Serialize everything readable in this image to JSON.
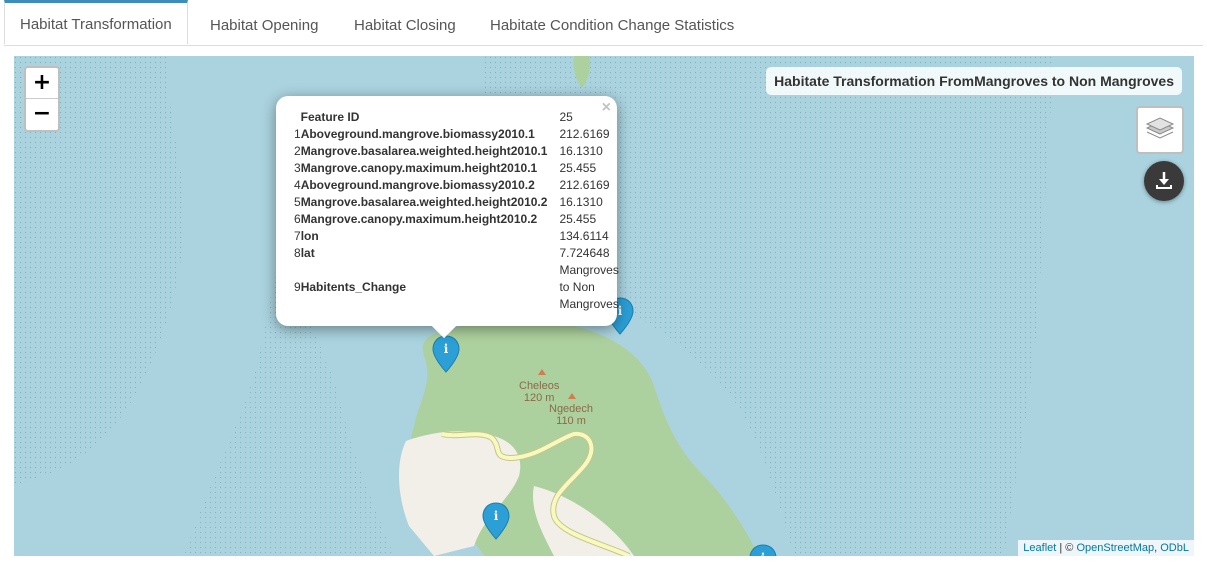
{
  "tabs": [
    {
      "label": "Habitat Transformation",
      "active": true
    },
    {
      "label": "Habitat Opening",
      "active": false
    },
    {
      "label": "Habitat Closing",
      "active": false
    },
    {
      "label": "Habitate Condition Change Statistics",
      "active": false
    }
  ],
  "map": {
    "title": "Habitate Transformation FromMangroves to Non Mangroves",
    "zoom_in": "+",
    "zoom_out": "−",
    "place_labels": [
      {
        "name": "Cheleos",
        "elevation": "120 m"
      },
      {
        "name": "Ngedech",
        "elevation": "110 m"
      }
    ],
    "attribution": {
      "leaflet": "Leaflet",
      "separator": " | © ",
      "osm": "OpenStreetMap",
      "comma": ", ",
      "odbl": "ODbL"
    },
    "icons": {
      "layers": "layers-icon",
      "download": "download-icon",
      "marker": "info-marker-icon"
    },
    "colors": {
      "water": "#aad3df",
      "land": "#add19e",
      "road": "#f7fabf",
      "marker": "#2b9fd6"
    }
  },
  "popup": {
    "close": "×",
    "header": {
      "key": "Feature ID",
      "value": "25"
    },
    "rows": [
      {
        "num": "1",
        "key": "Aboveground.mangrove.biomassy2010.1",
        "value": "212.6169"
      },
      {
        "num": "2",
        "key": "Mangrove.basalarea.weighted.height2010.1",
        "value": "16.1310"
      },
      {
        "num": "3",
        "key": "Mangrove.canopy.maximum.height2010.1",
        "value": "25.455"
      },
      {
        "num": "4",
        "key": "Aboveground.mangrove.biomassy2010.2",
        "value": "212.6169"
      },
      {
        "num": "5",
        "key": "Mangrove.basalarea.weighted.height2010.2",
        "value": "16.1310"
      },
      {
        "num": "6",
        "key": "Mangrove.canopy.maximum.height2010.2",
        "value": "25.455"
      },
      {
        "num": "7",
        "key": "lon",
        "value": "134.6114"
      },
      {
        "num": "8",
        "key": "lat",
        "value": "7.724648"
      },
      {
        "num": "9",
        "key": "Habitents_Change",
        "value": "Mangroves to Non Mangroves"
      }
    ]
  }
}
